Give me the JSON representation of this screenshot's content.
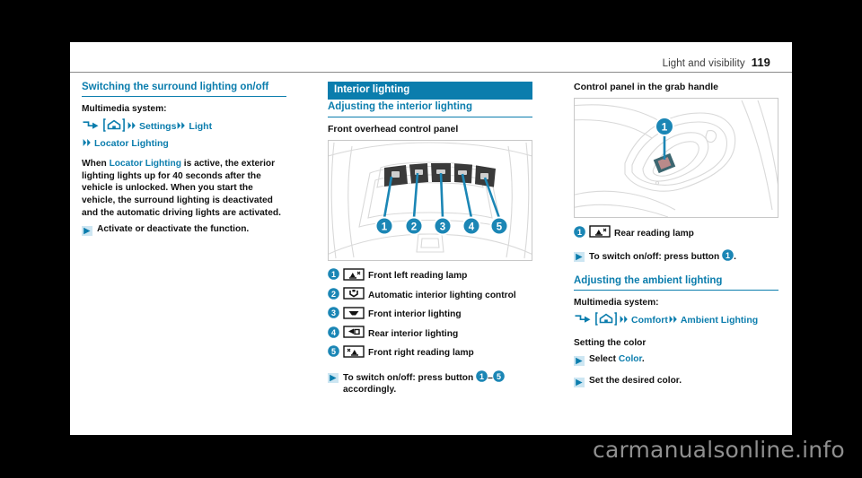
{
  "header": {
    "section_title": "Light and visibility",
    "page_number": "119"
  },
  "colors": {
    "accent": "#0b7dad",
    "heading_bar_bg": "#0b7dad",
    "heading_bar_text": "#ffffff",
    "body_text": "#111111",
    "watermark": "#8f8f8f"
  },
  "column_left": {
    "heading": "Switching the surround lighting on/off",
    "multimedia_label": "Multimedia system:",
    "path": {
      "start_icon": "corner-arrow-icon",
      "home_icon": "home-key-icon",
      "segments": [
        "Settings",
        "Light",
        "Locator Lighting"
      ]
    },
    "paragraph": "When Locator Lighting is active, the exterior lighting lights up for 40 seconds after the vehicle is unlocked. When you start the vehicle, the surround lighting is deactivated and the automatic driving lights are activated.",
    "paragraph_bold_term": "Locator Lighting",
    "steps": [
      "Activate or deactivate the function."
    ]
  },
  "column_middle": {
    "bar_heading": "Interior lighting",
    "rule_heading": "Adjusting the interior lighting",
    "figure_caption": "Front overhead control panel",
    "figure_name": "front-overhead-control-panel-illustration",
    "figure_callouts": [
      "1",
      "2",
      "3",
      "4",
      "5"
    ],
    "legend": [
      {
        "num": "1",
        "icon": "reading-lamp-left-icon",
        "label": "Front left reading lamp"
      },
      {
        "num": "2",
        "icon": "automatic-interior-lighting-icon",
        "label": "Automatic interior lighting control"
      },
      {
        "num": "3",
        "icon": "front-interior-lighting-icon",
        "label": "Front interior lighting"
      },
      {
        "num": "4",
        "icon": "rear-interior-lighting-icon",
        "label": "Rear interior lighting"
      },
      {
        "num": "5",
        "icon": "reading-lamp-right-icon",
        "label": "Front right reading lamp"
      }
    ],
    "step": {
      "text_before": "To switch on/off: press button",
      "badge_from": "1",
      "dash": "–",
      "badge_to": "5",
      "text_after": "accordingly."
    }
  },
  "column_right": {
    "figure_caption": "Control panel in the grab handle",
    "figure_name": "grab-handle-control-panel-illustration",
    "figure_callouts": [
      "1"
    ],
    "legend": [
      {
        "num": "1",
        "icon": "rear-reading-lamp-icon",
        "label": "Rear reading lamp"
      }
    ],
    "step": {
      "text_before": "To switch on/off: press button",
      "badge": "1",
      "text_after": "."
    },
    "rule_heading": "Adjusting the ambient lighting",
    "multimedia_label": "Multimedia system:",
    "path": {
      "start_icon": "corner-arrow-icon",
      "home_icon": "home-key-icon",
      "segments": [
        "Comfort",
        "Ambient Lighting"
      ]
    },
    "subheading": "Setting the color",
    "steps": [
      {
        "text": "Select Color.",
        "bold_term": "Color"
      },
      {
        "text": "Set the desired color."
      }
    ]
  },
  "watermark": "carmanualsonline.info"
}
